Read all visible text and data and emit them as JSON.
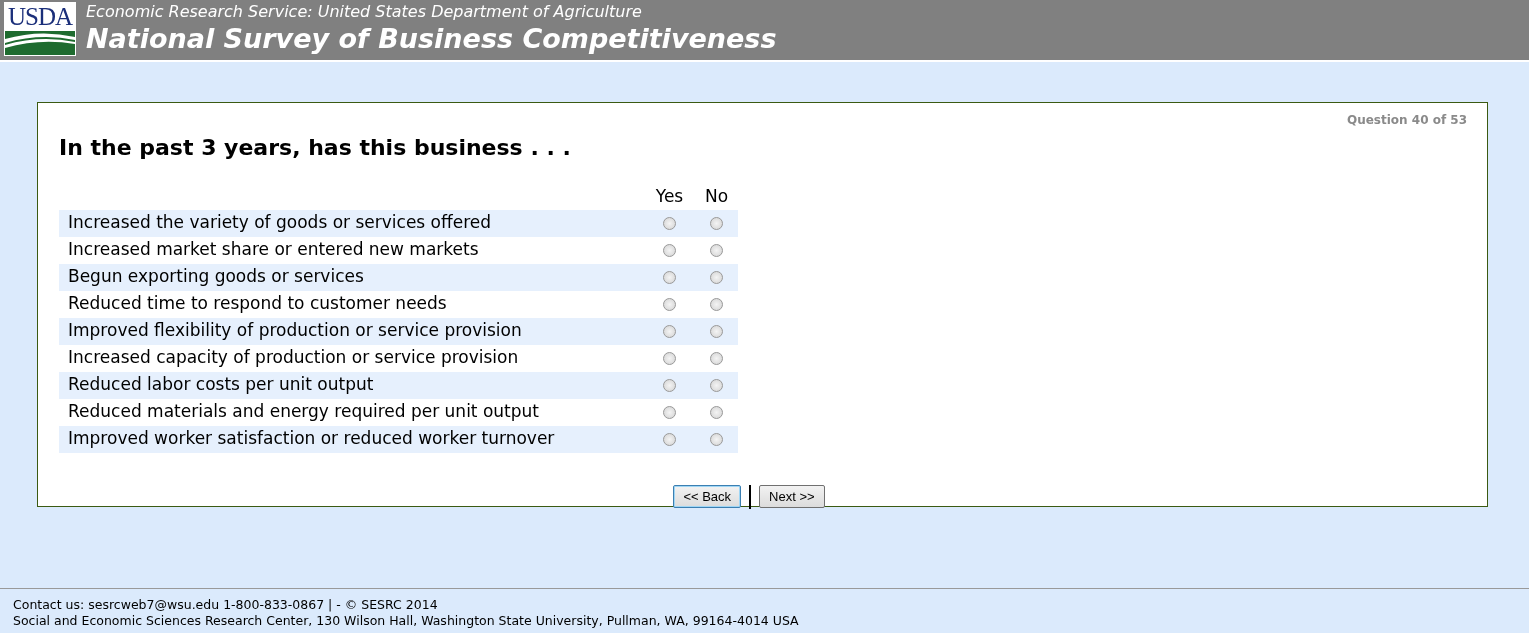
{
  "header": {
    "agency": "Economic Research Service: United States Department of Agriculture",
    "title": "National Survey of Business Competitiveness",
    "logo_text": "USDA"
  },
  "progress": "Question 40 of 53",
  "question": "In the past 3 years, has this business . . .",
  "columns": [
    "Yes",
    "No"
  ],
  "rows": [
    {
      "text": "Increased the variety of goods or services offered",
      "choices": [
        {
          "selected": false
        },
        {
          "selected": false
        }
      ]
    },
    {
      "text": "Increased market share or entered new markets",
      "choices": [
        {
          "selected": false
        },
        {
          "selected": false
        }
      ]
    },
    {
      "text": "Begun exporting goods or services",
      "choices": [
        {
          "selected": false
        },
        {
          "selected": false
        }
      ]
    },
    {
      "text": "Reduced time to respond to customer needs",
      "choices": [
        {
          "selected": false
        },
        {
          "selected": false
        }
      ]
    },
    {
      "text": "Improved flexibility of production or service provision",
      "choices": [
        {
          "selected": false
        },
        {
          "selected": false
        }
      ]
    },
    {
      "text": "Increased capacity of production or service provision",
      "choices": [
        {
          "selected": false
        },
        {
          "selected": false
        }
      ]
    },
    {
      "text": "Reduced labor costs per unit output",
      "choices": [
        {
          "selected": false
        },
        {
          "selected": false
        }
      ]
    },
    {
      "text": "Reduced materials and energy required per unit output",
      "choices": [
        {
          "selected": false
        },
        {
          "selected": false
        }
      ]
    },
    {
      "text": "Improved worker satisfaction or reduced worker turnover",
      "choices": [
        {
          "selected": false
        },
        {
          "selected": false
        }
      ]
    }
  ],
  "buttons": [
    {
      "label": "<< Back",
      "focused": true
    },
    {
      "label": "Next >>",
      "focused": false
    }
  ],
  "footer": [
    "Contact us: sesrcweb7@wsu.edu 1-800-833-0867 | - © SESRC 2014",
    "Social and Economic Sciences Research Center, 130 Wilson Hall, Washington State University, Pullman, WA, 99164-4014 USA"
  ]
}
